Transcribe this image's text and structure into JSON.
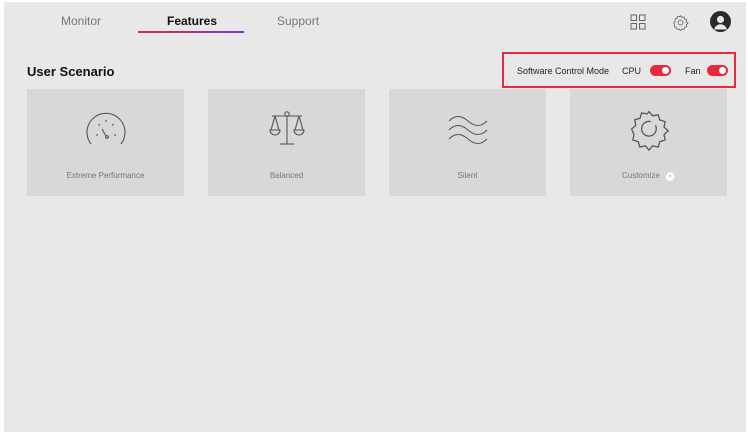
{
  "nav": {
    "tabs": [
      {
        "label": "Monitor",
        "active": false
      },
      {
        "label": "Features",
        "active": true
      },
      {
        "label": "Support",
        "active": false
      }
    ],
    "icons": [
      "grid-icon",
      "settings-icon",
      "user-avatar-icon"
    ]
  },
  "page": {
    "title": "User Scenario"
  },
  "control_mode": {
    "label": "Software Control Mode",
    "toggles": [
      {
        "label": "CPU",
        "on": true
      },
      {
        "label": "Fan",
        "on": true
      }
    ],
    "accent_color": "#e8283c"
  },
  "scenarios": [
    {
      "label": "Extreme Performance",
      "icon": "speedometer-icon"
    },
    {
      "label": "Balanced",
      "icon": "balance-scale-icon"
    },
    {
      "label": "Silent",
      "icon": "waves-icon"
    },
    {
      "label": "Customize",
      "icon": "gear-icon"
    }
  ],
  "colors": {
    "background": "#e8e8e8",
    "card": "#d8d8db",
    "accent_red": "#e8283c",
    "accent_purple": "#6c3bd6"
  }
}
